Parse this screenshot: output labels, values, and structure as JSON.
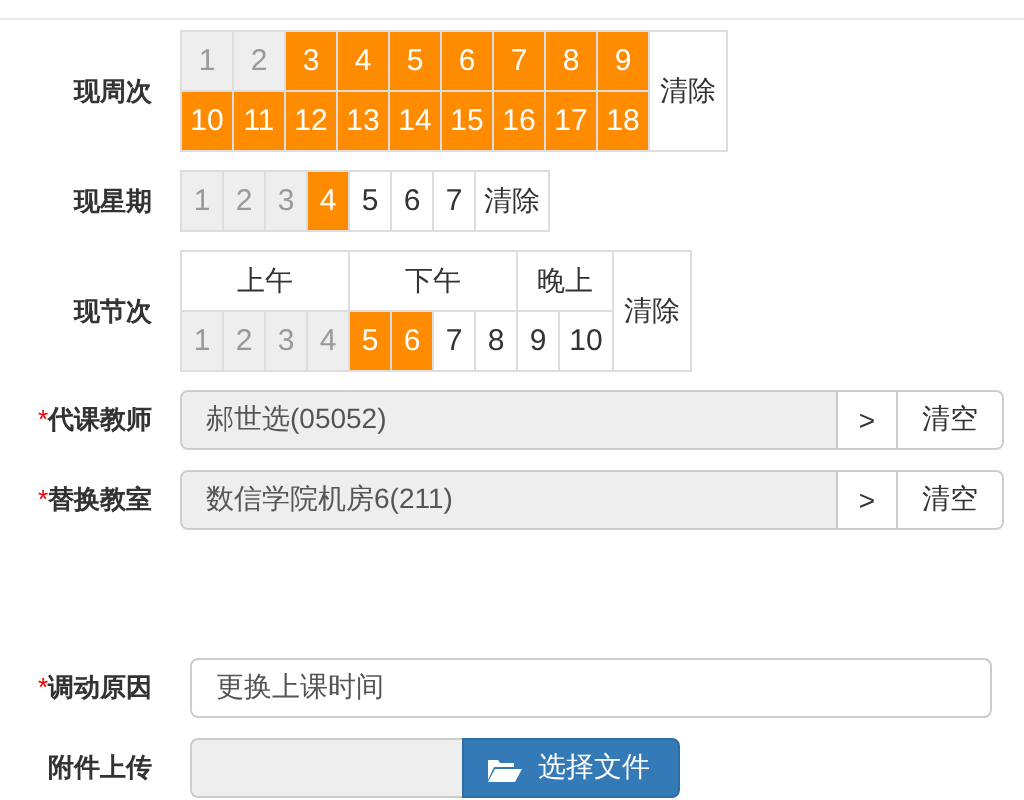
{
  "weeks": {
    "label": "现周次",
    "rows": [
      [
        {
          "text": "1",
          "disabled": true,
          "selected": false
        },
        {
          "text": "2",
          "disabled": true,
          "selected": false
        },
        {
          "text": "3",
          "disabled": false,
          "selected": true
        },
        {
          "text": "4",
          "disabled": false,
          "selected": true
        },
        {
          "text": "5",
          "disabled": false,
          "selected": true
        },
        {
          "text": "6",
          "disabled": false,
          "selected": true
        },
        {
          "text": "7",
          "disabled": false,
          "selected": true
        },
        {
          "text": "8",
          "disabled": false,
          "selected": true
        },
        {
          "text": "9",
          "disabled": false,
          "selected": true
        }
      ],
      [
        {
          "text": "10",
          "disabled": false,
          "selected": true
        },
        {
          "text": "11",
          "disabled": false,
          "selected": true
        },
        {
          "text": "12",
          "disabled": false,
          "selected": true
        },
        {
          "text": "13",
          "disabled": false,
          "selected": true
        },
        {
          "text": "14",
          "disabled": false,
          "selected": true
        },
        {
          "text": "15",
          "disabled": false,
          "selected": true
        },
        {
          "text": "16",
          "disabled": false,
          "selected": true
        },
        {
          "text": "17",
          "disabled": false,
          "selected": true
        },
        {
          "text": "18",
          "disabled": false,
          "selected": true
        }
      ]
    ],
    "clear": "清除"
  },
  "weekday": {
    "label": "现星期",
    "rows": [
      [
        {
          "text": "1",
          "disabled": true,
          "selected": false
        },
        {
          "text": "2",
          "disabled": true,
          "selected": false
        },
        {
          "text": "3",
          "disabled": true,
          "selected": false
        },
        {
          "text": "4",
          "disabled": false,
          "selected": true
        },
        {
          "text": "5",
          "disabled": false,
          "selected": false
        },
        {
          "text": "6",
          "disabled": false,
          "selected": false
        },
        {
          "text": "7",
          "disabled": false,
          "selected": false
        }
      ]
    ],
    "clear": "清除"
  },
  "periods": {
    "label": "现节次",
    "groups": [
      {
        "title": "上午",
        "cells": [
          {
            "text": "1",
            "disabled": true,
            "selected": false
          },
          {
            "text": "2",
            "disabled": true,
            "selected": false
          },
          {
            "text": "3",
            "disabled": true,
            "selected": false
          },
          {
            "text": "4",
            "disabled": true,
            "selected": false
          }
        ]
      },
      {
        "title": "下午",
        "cells": [
          {
            "text": "5",
            "disabled": false,
            "selected": true
          },
          {
            "text": "6",
            "disabled": false,
            "selected": true
          },
          {
            "text": "7",
            "disabled": false,
            "selected": false
          },
          {
            "text": "8",
            "disabled": false,
            "selected": false
          }
        ]
      },
      {
        "title": "晚上",
        "cells": [
          {
            "text": "9",
            "disabled": false,
            "selected": false
          },
          {
            "text": "10",
            "disabled": false,
            "selected": false
          }
        ]
      }
    ],
    "clear": "清除"
  },
  "substitute_teacher": {
    "label": "代课教师",
    "required_mark": "*",
    "value": "郝世选(05052)",
    "disabled": true,
    "pick": ">",
    "clear": "清空"
  },
  "classroom": {
    "label": "替换教室",
    "required_mark": "*",
    "value": "数信学院机房6(211)",
    "disabled": true,
    "pick": ">",
    "clear": "清空"
  },
  "reason": {
    "label": "调动原因",
    "required_mark": "*",
    "value": "更换上课时间"
  },
  "attachment": {
    "label": "附件上传",
    "button": "选择文件"
  }
}
